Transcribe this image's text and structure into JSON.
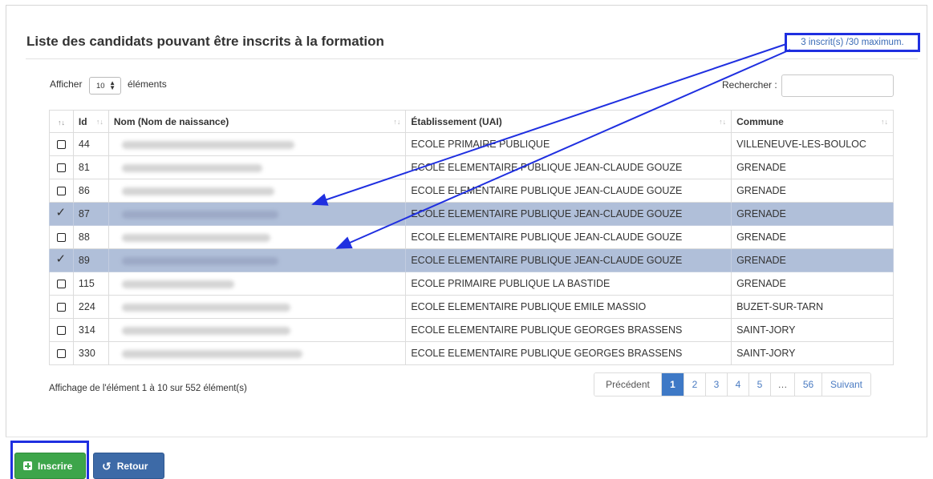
{
  "panel": {
    "title": "Liste des candidats pouvant être inscrits à la formation",
    "capacity": "3 inscrit(s) /30 maximum."
  },
  "controls": {
    "show_label": "Afficher",
    "page_length": "10",
    "elements_label": "éléments",
    "search_label": "Rechercher :",
    "search_value": ""
  },
  "table": {
    "columns": [
      "",
      "Id",
      "Nom (Nom de naissance)",
      "Établissement (UAI)",
      "Commune"
    ],
    "rows": [
      {
        "id": "44",
        "etab": "ECOLE PRIMAIRE PUBLIQUE",
        "commune": "VILLENEUVE-LES-BOULOC",
        "selected": false
      },
      {
        "id": "81",
        "etab": "ECOLE ELEMENTAIRE PUBLIQUE JEAN-CLAUDE GOUZE",
        "commune": "GRENADE",
        "selected": false
      },
      {
        "id": "86",
        "etab": "ECOLE ELEMENTAIRE PUBLIQUE JEAN-CLAUDE GOUZE",
        "commune": "GRENADE",
        "selected": false
      },
      {
        "id": "87",
        "etab": "ECOLE ELEMENTAIRE PUBLIQUE JEAN-CLAUDE GOUZE",
        "commune": "GRENADE",
        "selected": true
      },
      {
        "id": "88",
        "etab": "ECOLE ELEMENTAIRE PUBLIQUE JEAN-CLAUDE GOUZE",
        "commune": "GRENADE",
        "selected": false
      },
      {
        "id": "89",
        "etab": "ECOLE ELEMENTAIRE PUBLIQUE JEAN-CLAUDE GOUZE",
        "commune": "GRENADE",
        "selected": true
      },
      {
        "id": "115",
        "etab": "ECOLE PRIMAIRE PUBLIQUE LA BASTIDE",
        "commune": "GRENADE",
        "selected": false
      },
      {
        "id": "224",
        "etab": "ECOLE ELEMENTAIRE PUBLIQUE EMILE MASSIO",
        "commune": "BUZET-SUR-TARN",
        "selected": false
      },
      {
        "id": "314",
        "etab": "ECOLE ELEMENTAIRE PUBLIQUE GEORGES BRASSENS",
        "commune": "SAINT-JORY",
        "selected": false
      },
      {
        "id": "330",
        "etab": "ECOLE ELEMENTAIRE PUBLIQUE GEORGES BRASSENS",
        "commune": "SAINT-JORY",
        "selected": false
      }
    ]
  },
  "info": "Affichage de l'élément 1 à 10 sur 552 élément(s)",
  "pagination": {
    "previous": "Précédent",
    "pages": [
      "1",
      "2",
      "3",
      "4",
      "5",
      "…",
      "56"
    ],
    "active": "1",
    "next": "Suivant"
  },
  "actions": {
    "inscrire": "Inscrire",
    "retour": "Retour"
  },
  "icons": {
    "sort": "sort-icon",
    "plus": "plus-square-icon",
    "undo": "undo-icon",
    "select_arrows": "select-arrows-icon"
  },
  "colors": {
    "selected_row": "#b0bfd9",
    "primary": "#3e79c6",
    "success": "#3da54a",
    "annotation": "#1f2fe0"
  }
}
